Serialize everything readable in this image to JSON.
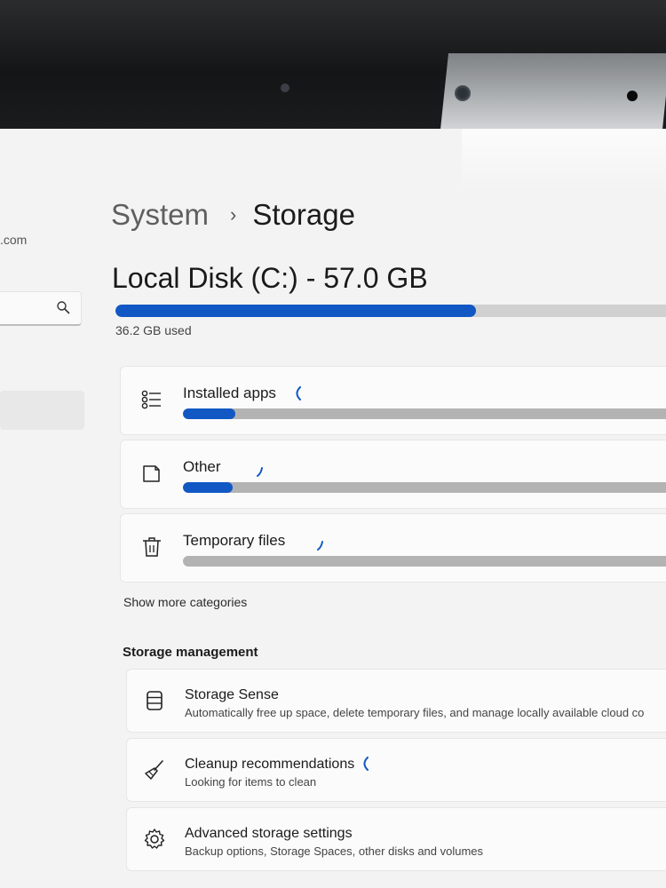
{
  "sidebar": {
    "account_email": ".com",
    "search_icon": "search-icon"
  },
  "breadcrumb": {
    "root": "System",
    "separator": "›",
    "current": "Storage"
  },
  "disk": {
    "title": "Local Disk (C:) - 57.0 GB",
    "used_text": "36.2 GB used",
    "used_fraction": 0.635
  },
  "categories": [
    {
      "label": "Installed apps",
      "icon": "apps-list-icon",
      "fill_fraction": 0.105,
      "loading": true
    },
    {
      "label": "Other",
      "icon": "other-file-icon",
      "fill_fraction": 0.1,
      "loading": true
    },
    {
      "label": "Temporary files",
      "icon": "trash-icon",
      "fill_fraction": 0.0,
      "loading": true
    }
  ],
  "show_more_label": "Show more categories",
  "storage_management": {
    "heading": "Storage management",
    "items": [
      {
        "title": "Storage Sense",
        "description": "Automatically free up space, delete temporary files, and manage locally available cloud co",
        "icon": "storage-sense-icon",
        "loading": false
      },
      {
        "title": "Cleanup recommendations",
        "description": "Looking for items to clean",
        "icon": "broom-icon",
        "loading": true
      },
      {
        "title": "Advanced storage settings",
        "description": "Backup options, Storage Spaces, other disks and volumes",
        "icon": "gear-icon",
        "loading": false
      }
    ]
  },
  "colors": {
    "accent": "#1158c4",
    "bar_track": "#b3b3b3",
    "screen_bg": "#f3f3f3"
  }
}
